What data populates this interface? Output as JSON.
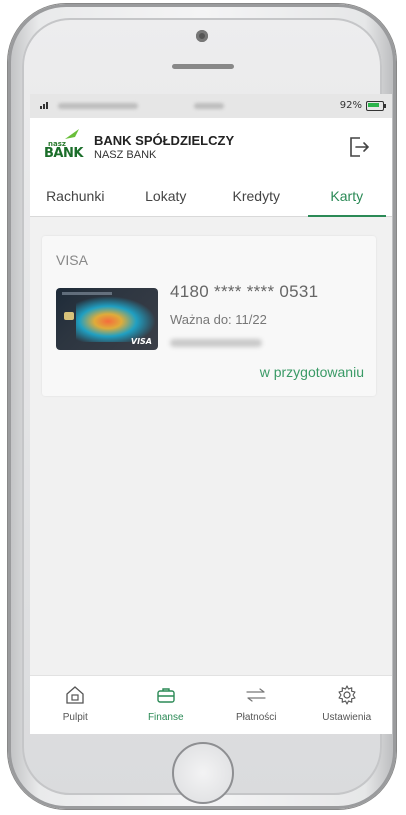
{
  "status_bar": {
    "battery": "92%"
  },
  "header": {
    "logo_small": "nasz",
    "logo_big": "BANK",
    "title": "BANK SPÓŁDZIELCZY",
    "subtitle": "NASZ BANK"
  },
  "tabs": [
    {
      "label": "Rachunki",
      "active": false
    },
    {
      "label": "Lokaty",
      "active": false
    },
    {
      "label": "Kredyty",
      "active": false
    },
    {
      "label": "Karty",
      "active": true
    }
  ],
  "card": {
    "type": "VISA",
    "number": "4180 **** **** 0531",
    "valid": "Ważna do: 11/22",
    "status": "w przygotowaniu",
    "image_brand": "VISA"
  },
  "bottom_nav": [
    {
      "label": "Pulpit",
      "icon": "home-icon",
      "active": false
    },
    {
      "label": "Finanse",
      "icon": "briefcase-icon",
      "active": true
    },
    {
      "label": "Płatności",
      "icon": "transfer-icon",
      "active": false
    },
    {
      "label": "Ustawienia",
      "icon": "gear-icon",
      "active": false
    }
  ],
  "colors": {
    "accent": "#2b8a56",
    "status_text": "#3a9a66"
  }
}
